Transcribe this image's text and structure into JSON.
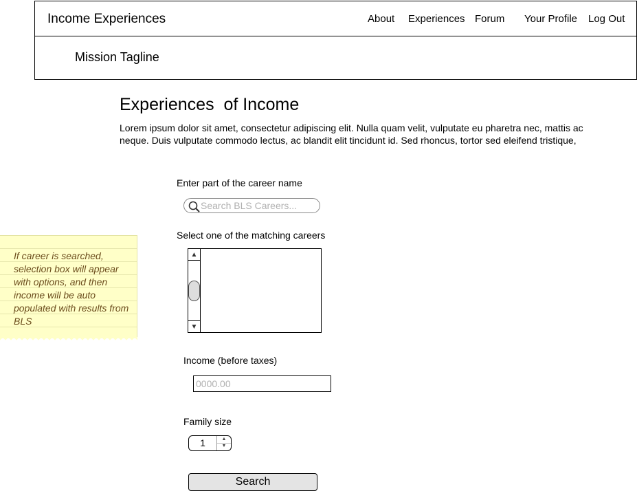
{
  "header": {
    "site_title": "Income Experiences",
    "tagline": "Mission Tagline",
    "nav": {
      "about": "About",
      "experiences": "Experiences",
      "forum": "Forum",
      "profile": "Your Profile",
      "logout": "Log Out"
    }
  },
  "main": {
    "title": "Experiences  of Income",
    "intro": "Lorem ipsum dolor sit amet, consectetur adipiscing elit. Nulla quam velit, vulputate eu pharetra nec, mattis ac neque. Duis vulputate commodo lectus, ac blandit elit tincidunt id. Sed rhoncus, tortor sed eleifend tristique,"
  },
  "form": {
    "career_label": "Enter part of  the career name",
    "career_placeholder": "Search BLS Careers...",
    "select_label": "Select one of the matching careers",
    "income_label": "Income (before taxes)",
    "income_placeholder": "0000.00",
    "family_label": "Family size",
    "family_value": "1",
    "search_button": "Search"
  },
  "note": {
    "text": "If career is searched, selection box will appear with options, and then income will be auto populated with results from BLS"
  },
  "icons": {
    "search": "search-icon",
    "scroll_up": "arrow-up-icon",
    "scroll_down": "arrow-down-icon",
    "step_up": "chevron-up-icon",
    "step_down": "chevron-down-icon"
  },
  "colors": {
    "sticky_note": "#ffffc8",
    "sticky_text": "#6b4c1c",
    "button_bg": "#e4e4e4",
    "placeholder": "#b0b0b0"
  }
}
